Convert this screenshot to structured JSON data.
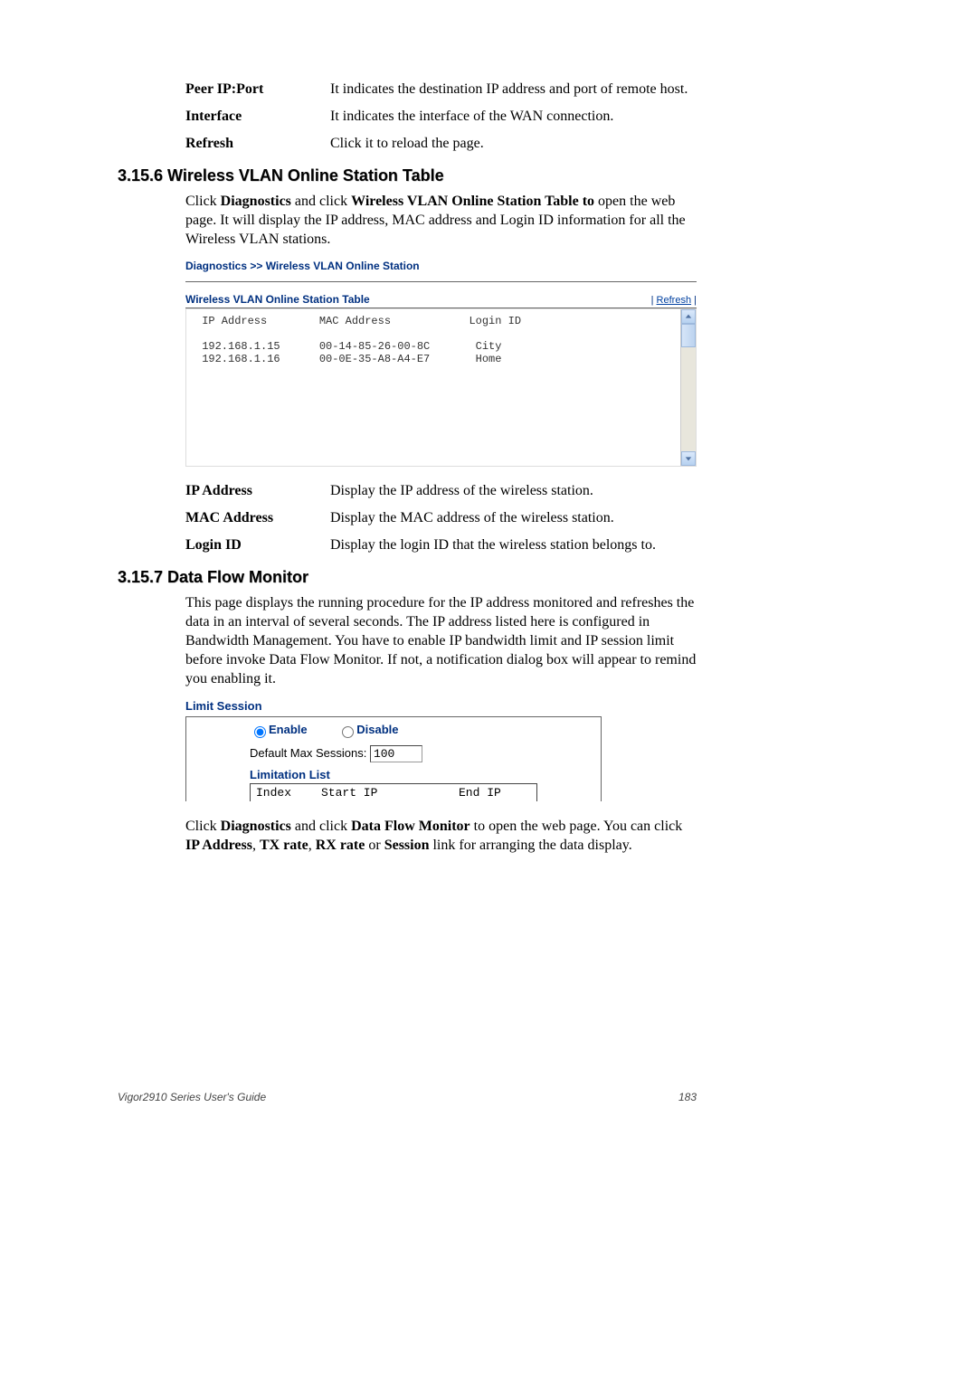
{
  "def1": {
    "peer_ip_port": {
      "term": "Peer IP:Port",
      "desc": "It indicates the destination IP address and port of remote host."
    },
    "interface": {
      "term": "Interface",
      "desc": "It indicates the interface of the WAN connection."
    },
    "refresh": {
      "term": "Refresh",
      "desc": "Click it to reload the page."
    }
  },
  "section1": {
    "heading": "3.15.6 Wireless VLAN Online Station Table",
    "body": "Click Diagnostics and click Wireless VLAN Online Station Table to open the web page. It will display the IP address, MAC address and Login ID information for all the Wireless VLAN stations."
  },
  "diag": {
    "breadcrumb": "Diagnostics >> Wireless VLAN Online Station",
    "table_title": "Wireless VLAN Online Station Table",
    "refresh_sep": "|  ",
    "refresh_link": "Refresh",
    "refresh_sep2": "  |",
    "columns": {
      "ip": "IP Address",
      "mac": "MAC Address",
      "login": "Login ID"
    },
    "rows": [
      {
        "ip": "192.168.1.15",
        "mac": "00-14-85-26-00-8C",
        "login": "City"
      },
      {
        "ip": "192.168.1.16",
        "mac": "00-0E-35-A8-A4-E7",
        "login": "Home"
      }
    ]
  },
  "def2": {
    "ip_address": {
      "term": "IP Address",
      "desc": "Display the IP address of the wireless station."
    },
    "mac_address": {
      "term": "MAC Address",
      "desc": "Display the MAC address of the wireless station."
    },
    "login_id": {
      "term": "Login ID",
      "desc": "Display the login ID that the wireless station belongs to."
    }
  },
  "section2": {
    "heading": "3.15.7 Data Flow Monitor",
    "body": "This page displays the running procedure for the IP address monitored and refreshes the data in an interval of several seconds. The IP address listed here is configured in Bandwidth Management. You have to enable IP bandwidth limit and IP session limit before invoke Data Flow Monitor. If not, a notification dialog box will appear to remind you enabling it."
  },
  "limit": {
    "title": "Limit Session",
    "enable": "Enable",
    "disable": "Disable",
    "sessions_label": "Default Max Sessions: ",
    "sessions_value": "100",
    "list_title": "Limitation List",
    "col_index": "Index",
    "col_start": "Start IP",
    "col_end": "End IP"
  },
  "closing": "Click Diagnostics and click Data Flow Monitor to open the web page. You can click IP Address, TX rate, RX rate or Session link for arranging the data display.",
  "footer": {
    "left": "Vigor2910 Series User's Guide",
    "right": "183"
  }
}
